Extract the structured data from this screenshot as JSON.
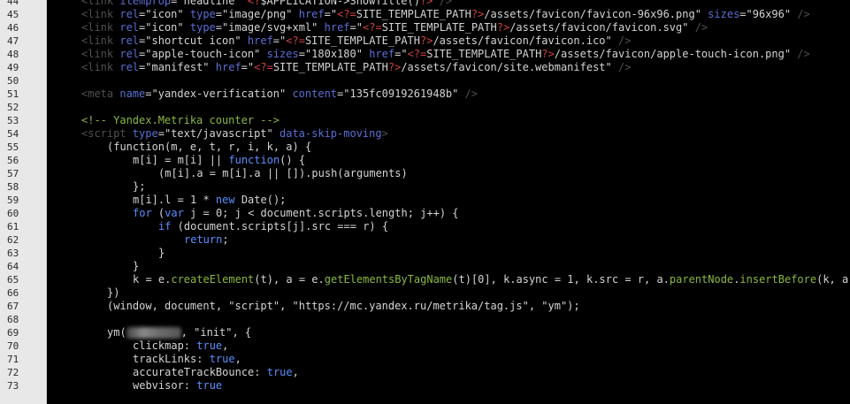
{
  "colors": {
    "tag": "#505050",
    "attr": "#5a6fd6",
    "value": "#d4d4d4",
    "php": "#d04040",
    "plain": "#d4d4d4",
    "keyword": "#5a8fff",
    "method": "#8ab840",
    "punct": "#d4d4d4",
    "comment": "#8ab840"
  },
  "lines": [
    {
      "n": "44",
      "indent": 0,
      "tokens": [
        [
          "tag",
          "<link "
        ],
        [
          "attr",
          "itemprop"
        ],
        [
          "plain",
          "="
        ],
        [
          "value",
          "\"headline\""
        ],
        [
          "plain",
          " "
        ],
        [
          "php",
          "<?"
        ],
        [
          "plain",
          "$APPLICATION->ShowTitle()"
        ],
        [
          "php",
          "?>"
        ],
        [
          "tag",
          " />"
        ]
      ]
    },
    {
      "n": "45",
      "indent": 0,
      "tokens": [
        [
          "tag",
          "<link "
        ],
        [
          "attr",
          "rel"
        ],
        [
          "plain",
          "="
        ],
        [
          "value",
          "\"icon\""
        ],
        [
          "plain",
          " "
        ],
        [
          "attr",
          "type"
        ],
        [
          "plain",
          "="
        ],
        [
          "value",
          "\"image/png\""
        ],
        [
          "plain",
          " "
        ],
        [
          "attr",
          "href"
        ],
        [
          "plain",
          "="
        ],
        [
          "value",
          "\""
        ],
        [
          "php",
          "<?="
        ],
        [
          "value",
          "SITE_TEMPLATE_PATH"
        ],
        [
          "php",
          "?>"
        ],
        [
          "value",
          "/assets/favicon/favicon-96x96.png\""
        ],
        [
          "plain",
          " "
        ],
        [
          "attr",
          "sizes"
        ],
        [
          "plain",
          "="
        ],
        [
          "value",
          "\"96x96\""
        ],
        [
          "tag",
          " />"
        ]
      ]
    },
    {
      "n": "46",
      "indent": 0,
      "tokens": [
        [
          "tag",
          "<link "
        ],
        [
          "attr",
          "rel"
        ],
        [
          "plain",
          "="
        ],
        [
          "value",
          "\"icon\""
        ],
        [
          "plain",
          " "
        ],
        [
          "attr",
          "type"
        ],
        [
          "plain",
          "="
        ],
        [
          "value",
          "\"image/svg+xml\""
        ],
        [
          "plain",
          " "
        ],
        [
          "attr",
          "href"
        ],
        [
          "plain",
          "="
        ],
        [
          "value",
          "\""
        ],
        [
          "php",
          "<?="
        ],
        [
          "value",
          "SITE_TEMPLATE_PATH"
        ],
        [
          "php",
          "?>"
        ],
        [
          "value",
          "/assets/favicon/favicon.svg\""
        ],
        [
          "tag",
          " />"
        ]
      ]
    },
    {
      "n": "47",
      "indent": 0,
      "tokens": [
        [
          "tag",
          "<link "
        ],
        [
          "attr",
          "rel"
        ],
        [
          "plain",
          "="
        ],
        [
          "value",
          "\"shortcut icon\""
        ],
        [
          "plain",
          " "
        ],
        [
          "attr",
          "href"
        ],
        [
          "plain",
          "="
        ],
        [
          "value",
          "\""
        ],
        [
          "php",
          "<?="
        ],
        [
          "value",
          "SITE_TEMPLATE_PATH"
        ],
        [
          "php",
          "?>"
        ],
        [
          "value",
          "/assets/favicon/favicon.ico\""
        ],
        [
          "tag",
          " />"
        ]
      ]
    },
    {
      "n": "48",
      "indent": 0,
      "tokens": [
        [
          "tag",
          "<link "
        ],
        [
          "attr",
          "rel"
        ],
        [
          "plain",
          "="
        ],
        [
          "value",
          "\"apple-touch-icon\""
        ],
        [
          "plain",
          " "
        ],
        [
          "attr",
          "sizes"
        ],
        [
          "plain",
          "="
        ],
        [
          "value",
          "\"180x180\""
        ],
        [
          "plain",
          " "
        ],
        [
          "attr",
          "href"
        ],
        [
          "plain",
          "="
        ],
        [
          "value",
          "\""
        ],
        [
          "php",
          "<?="
        ],
        [
          "value",
          "SITE_TEMPLATE_PATH"
        ],
        [
          "php",
          "?>"
        ],
        [
          "value",
          "/assets/favicon/apple-touch-icon.png\""
        ],
        [
          "tag",
          " />"
        ]
      ]
    },
    {
      "n": "49",
      "indent": 0,
      "tokens": [
        [
          "tag",
          "<link "
        ],
        [
          "attr",
          "rel"
        ],
        [
          "plain",
          "="
        ],
        [
          "value",
          "\"manifest\""
        ],
        [
          "plain",
          " "
        ],
        [
          "attr",
          "href"
        ],
        [
          "plain",
          "="
        ],
        [
          "value",
          "\""
        ],
        [
          "php",
          "<?="
        ],
        [
          "value",
          "SITE_TEMPLATE_PATH"
        ],
        [
          "php",
          "?>"
        ],
        [
          "value",
          "/assets/favicon/site.webmanifest\""
        ],
        [
          "tag",
          " />"
        ]
      ]
    },
    {
      "n": "50",
      "indent": 0,
      "tokens": []
    },
    {
      "n": "51",
      "indent": 0,
      "tokens": [
        [
          "tag",
          "<meta "
        ],
        [
          "attr",
          "name"
        ],
        [
          "plain",
          "="
        ],
        [
          "value",
          "\"yandex-verification\""
        ],
        [
          "plain",
          " "
        ],
        [
          "attr",
          "content"
        ],
        [
          "plain",
          "="
        ],
        [
          "value",
          "\"135fc0919261948b\""
        ],
        [
          "tag",
          " />"
        ]
      ]
    },
    {
      "n": "52",
      "indent": 0,
      "tokens": []
    },
    {
      "n": "53",
      "indent": 0,
      "tokens": [
        [
          "comment",
          "<!-- Yandex.Metrika counter -->"
        ]
      ]
    },
    {
      "n": "54",
      "indent": 0,
      "tokens": [
        [
          "tag",
          "<script "
        ],
        [
          "attr",
          "type"
        ],
        [
          "plain",
          "="
        ],
        [
          "value",
          "\"text/javascript\""
        ],
        [
          "plain",
          " "
        ],
        [
          "attr",
          "data-skip-moving"
        ],
        [
          "tag",
          ">"
        ]
      ]
    },
    {
      "n": "55",
      "indent": 1,
      "tokens": [
        [
          "plain",
          "(function(m, e, t, r, i, k, a) {"
        ]
      ]
    },
    {
      "n": "56",
      "indent": 2,
      "tokens": [
        [
          "plain",
          "m[i] = m[i] || "
        ],
        [
          "keyword",
          "function"
        ],
        [
          "plain",
          "() {"
        ]
      ]
    },
    {
      "n": "57",
      "indent": 3,
      "tokens": [
        [
          "plain",
          "(m[i].a = m[i].a || []).push(arguments)"
        ]
      ]
    },
    {
      "n": "58",
      "indent": 2,
      "tokens": [
        [
          "plain",
          "};"
        ]
      ]
    },
    {
      "n": "59",
      "indent": 2,
      "tokens": [
        [
          "plain",
          "m[i].l = 1 * "
        ],
        [
          "keyword",
          "new"
        ],
        [
          "plain",
          " Date();"
        ]
      ]
    },
    {
      "n": "60",
      "indent": 2,
      "tokens": [
        [
          "keyword",
          "for"
        ],
        [
          "plain",
          " ("
        ],
        [
          "keyword",
          "var"
        ],
        [
          "plain",
          " j = 0; j < document.scripts.length; j++) {"
        ]
      ]
    },
    {
      "n": "61",
      "indent": 3,
      "tokens": [
        [
          "keyword",
          "if"
        ],
        [
          "plain",
          " (document.scripts[j].src === r) {"
        ]
      ]
    },
    {
      "n": "62",
      "indent": 4,
      "tokens": [
        [
          "keyword",
          "return"
        ],
        [
          "plain",
          ";"
        ]
      ]
    },
    {
      "n": "63",
      "indent": 3,
      "tokens": [
        [
          "plain",
          "}"
        ]
      ]
    },
    {
      "n": "64",
      "indent": 2,
      "tokens": [
        [
          "plain",
          "}"
        ]
      ]
    },
    {
      "n": "65",
      "indent": 2,
      "tokens": [
        [
          "plain",
          "k = e."
        ],
        [
          "method",
          "createElement"
        ],
        [
          "plain",
          "(t), a = e."
        ],
        [
          "method",
          "getElementsByTagName"
        ],
        [
          "plain",
          "(t)[0], k.async = 1, k.src = r, a."
        ],
        [
          "method",
          "parentNode"
        ],
        [
          "plain",
          "."
        ],
        [
          "method",
          "insertBefore"
        ],
        [
          "plain",
          "(k, a)"
        ]
      ]
    },
    {
      "n": "66",
      "indent": 1,
      "tokens": [
        [
          "plain",
          "})"
        ]
      ]
    },
    {
      "n": "67",
      "indent": 1,
      "tokens": [
        [
          "plain",
          "(window, document, \"script\", \"https://mc.yandex.ru/metrika/tag.js\", \"ym\");"
        ]
      ]
    },
    {
      "n": "68",
      "indent": 0,
      "tokens": []
    },
    {
      "n": "69",
      "indent": 1,
      "tokens": [
        [
          "plain",
          "ym("
        ],
        [
          "blur",
          ""
        ],
        [
          "plain",
          ", \"init\", {"
        ]
      ]
    },
    {
      "n": "70",
      "indent": 2,
      "tokens": [
        [
          "plain",
          "clickmap: "
        ],
        [
          "keyword",
          "true"
        ],
        [
          "plain",
          ","
        ]
      ]
    },
    {
      "n": "71",
      "indent": 2,
      "tokens": [
        [
          "plain",
          "trackLinks: "
        ],
        [
          "keyword",
          "true"
        ],
        [
          "plain",
          ","
        ]
      ]
    },
    {
      "n": "72",
      "indent": 2,
      "tokens": [
        [
          "plain",
          "accurateTrackBounce: "
        ],
        [
          "keyword",
          "true"
        ],
        [
          "plain",
          ","
        ]
      ]
    },
    {
      "n": "73",
      "indent": 2,
      "tokens": [
        [
          "plain",
          "webvisor: "
        ],
        [
          "keyword",
          "true"
        ]
      ]
    }
  ]
}
